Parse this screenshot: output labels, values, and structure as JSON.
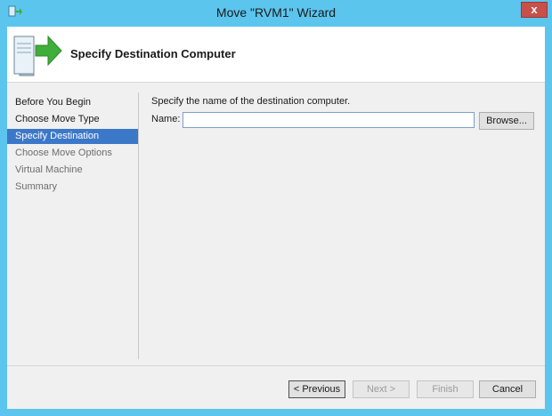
{
  "window": {
    "title": "Move \"RVM1\" Wizard",
    "close_label": "x"
  },
  "header": {
    "title": "Specify Destination Computer"
  },
  "nav": {
    "items": [
      {
        "label": "Before You Begin"
      },
      {
        "label": "Choose Move Type"
      },
      {
        "label": "Specify Destination"
      },
      {
        "label": "Choose Move Options"
      },
      {
        "label": "Virtual Machine"
      },
      {
        "label": "Summary"
      }
    ]
  },
  "content": {
    "instruction": "Specify the name of the destination computer.",
    "name_label": "Name:",
    "name_value": "",
    "browse_label": "Browse..."
  },
  "footer": {
    "previous_label": "< Previous",
    "next_label": "Next >",
    "finish_label": "Finish",
    "cancel_label": "Cancel"
  },
  "colors": {
    "titlebar": "#5bc5ee",
    "selection": "#3c78c8",
    "close": "#c7504b"
  },
  "icons": [
    "app-icon",
    "server-move-icon",
    "close-icon"
  ]
}
